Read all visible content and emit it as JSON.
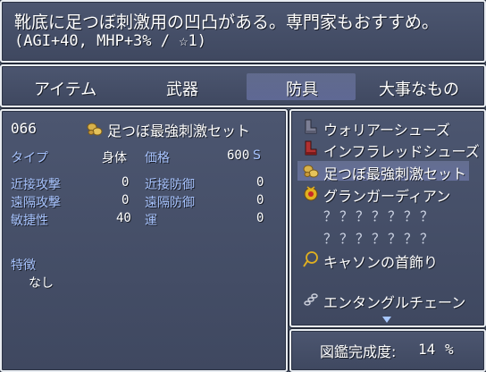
{
  "help": {
    "line1": "靴底に足つぼ刺激用の凹凸がある。専門家もおすすめ。",
    "line2": "(AGI+40, MHP+3% / ☆1)"
  },
  "tabs": [
    {
      "label": "アイテム"
    },
    {
      "label": "武器"
    },
    {
      "label": "防具"
    },
    {
      "label": "大事なもの"
    }
  ],
  "selected_tab": "防具",
  "detail": {
    "id": "066",
    "name": "足つぼ最強刺激セット",
    "type_label": "タイプ",
    "type_value": "身体",
    "price_label": "価格",
    "price_value": "600",
    "price_unit": "S",
    "stats": [
      {
        "label": "近接攻撃",
        "value": "0"
      },
      {
        "label": "近接防御",
        "value": "0"
      },
      {
        "label": "遠隔攻撃",
        "value": "0"
      },
      {
        "label": "遠隔防御",
        "value": "0"
      },
      {
        "label": "敏捷性",
        "value": "40"
      },
      {
        "label": "運",
        "value": "0"
      }
    ],
    "features_label": "特徴",
    "features_value": "なし"
  },
  "list": {
    "items": [
      {
        "name": "ウォリアーシューズ",
        "icon": "boots-icon"
      },
      {
        "name": "インフラレッドシューズ",
        "icon": "red-boots-icon"
      },
      {
        "name": "足つぼ最強刺激セット",
        "icon": "pebbles-icon"
      },
      {
        "name": "グランガーディアン",
        "icon": "amulet-icon"
      },
      {
        "name": "？？？？？？？"
      },
      {
        "name": "？？？？？？？"
      },
      {
        "name": "キャソンの首飾り",
        "icon": "necklace-icon"
      },
      {
        "name": "エンタングルチェーン",
        "icon": "chain-icon"
      }
    ],
    "selected_index": 2
  },
  "completion": {
    "label": "図鑑完成度:",
    "value": "14",
    "unit": "%"
  },
  "colors": {
    "window_bg": "#4a5468",
    "label_blue": "#a8c4ff",
    "border": "#e9edf2"
  }
}
